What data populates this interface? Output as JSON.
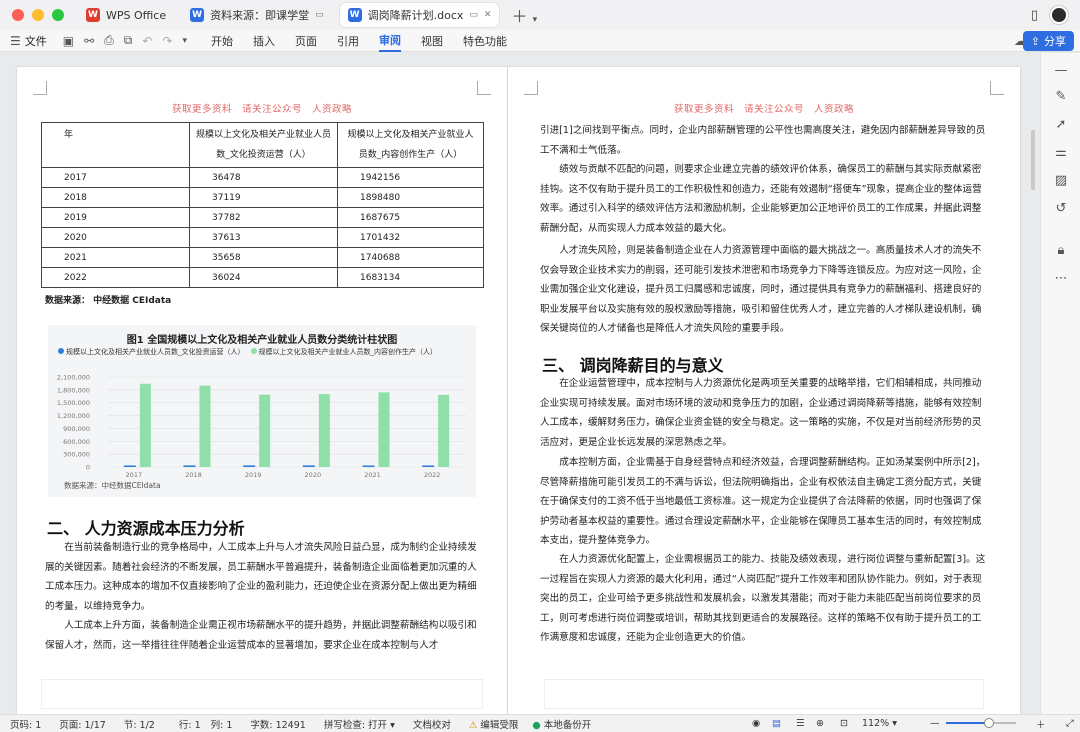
{
  "titlebar": {
    "tabs": [
      {
        "label": "WPS Office",
        "icon": "wps-icon",
        "color": "#e03c2f"
      },
      {
        "label": "资料来源：即课学堂",
        "icon": "word-doc-icon",
        "color": "#2f6ee0"
      },
      {
        "label": "调岗降薪计划.docx",
        "icon": "word-doc-icon",
        "color": "#2f6ee0"
      }
    ]
  },
  "toolbar": {
    "file": "文件",
    "menus": [
      "开始",
      "插入",
      "页面",
      "引用",
      "审阅",
      "视图",
      "特色功能"
    ],
    "active_menu": "审阅",
    "share": "分享"
  },
  "left_page": {
    "watermark": "获取更多资料　请关注公众号　人资政略",
    "table": {
      "headers": [
        "年",
        "规模以上文化及相关产业就业人员数_文化投资运营（人）",
        "规模以上文化及相关产业就业人员数_内容创作生产（人）"
      ],
      "rows": [
        [
          "2017",
          "36478",
          "1942156"
        ],
        [
          "2018",
          "37119",
          "1898480"
        ],
        [
          "2019",
          "37782",
          "1687675"
        ],
        [
          "2020",
          "37613",
          "1701432"
        ],
        [
          "2021",
          "35658",
          "1740688"
        ],
        [
          "2022",
          "36024",
          "1683134"
        ]
      ]
    },
    "source": "数据来源：  中经数据 CEIdata",
    "chart_source": "数据来源：中经数据CEIdata",
    "section_title": "二、  人力资源成本压力分析",
    "paragraphs": [
      "在当前装备制造行业的竞争格局中，人工成本上升与人才流失风险日益凸显，成为制约企业持续发展的关键因素。随着社会经济的不断发展，员工薪酬水平普遍提升，装备制造企业面临着更加沉重的人工成本压力。这种成本的增加不仅直接影响了企业的盈利能力，还迫使企业在资源分配上做出更为精细的考量，以维持竞争力。",
      "人工成本上升方面，装备制造企业需正视市场薪酬水平的提升趋势，并据此调整薪酬结构以吸引和保留人才，然而，这一举措往往伴随着企业运营成本的显著增加，要求企业在成本控制与人才"
    ]
  },
  "chart_data": {
    "type": "bar",
    "title": "图1 全国规模以上文化及相关产业就业人员数分类统计柱状图",
    "categories": [
      "2017",
      "2018",
      "2019",
      "2020",
      "2021",
      "2022"
    ],
    "series": [
      {
        "name": "规模以上文化及相关产业就业人员数_文化投资运营（人）",
        "values": [
          36478,
          37119,
          37782,
          37613,
          35658,
          36024
        ],
        "color": "#2f7fd8"
      },
      {
        "name": "规模以上文化及相关产业就业人员数_内容创作生产（人）",
        "values": [
          1942156,
          1898480,
          1687675,
          1701432,
          1740688,
          1683134
        ],
        "color": "#8fe0a8"
      }
    ],
    "yticks": [
      "0",
      "300,000",
      "600,000",
      "900,000",
      "1,200,000",
      "1,500,000",
      "1,800,000",
      "2,100,000"
    ],
    "ylim": [
      0,
      2100000
    ],
    "legend": "top-left",
    "grid": true
  },
  "right_page": {
    "watermark": "获取更多资料　请关注公众号　人资政略",
    "para1": "引进[1]之间找到平衡点。同时，企业内部薪酬管理的公平性也需高度关注，避免因内部薪酬差异导致的员工不满和士气低落。",
    "para2": "绩效与贡献不匹配的问题，则要求企业建立完善的绩效评价体系，确保员工的薪酬与其实际贡献紧密挂钩。这不仅有助于提升员工的工作积极性和创造力，还能有效遏制“搭便车”现象，提高企业的整体运营效率。通过引入科学的绩效评估方法和激励机制，企业能够更加公正地评价员工的工作成果，并据此调整薪酬分配，从而实现人力成本效益的最大化。",
    "para3": "人才流失风险，则是装备制造企业在人力资源管理中面临的最大挑战之一。高质量技术人才的流失不仅会导致企业技术实力的削弱，还可能引发技术泄密和市场竞争力下降等连锁反应。为应对这一风险，企业需加强企业文化建设，提升员工归属感和忠诚度，同时，通过提供具有竞争力的薪酬福利、搭建良好的职业发展平台以及实施有效的股权激励等措施，吸引和留住优秀人才，建立完善的人才梯队建设机制，确保关键岗位的人才储备也是降低人才流失风险的重要手段。",
    "section_title": "三、  调岗降薪目的与意义",
    "para4": "在企业运营管理中，成本控制与人力资源优化是两项至关重要的战略举措，它们相辅相成，共同推动企业实现可持续发展。面对市场环境的波动和竞争压力的加剧，企业通过调岗降薪等措施，能够有效控制人工成本，缓解财务压力，确保企业资金链的安全与稳定。这一策略的实施，不仅是对当前经济形势的灵活应对，更是企业长远发展的深思熟虑之举。",
    "para5": "成本控制方面，企业需基于自身经营特点和经济效益，合理调整薪酬结构。正如汤某案例中所示[2]，尽管降薪措施可能引发员工的不满与诉讼，但法院明确指出，企业有权依法自主确定工资分配方式，关键在于确保支付的工资不低于当地最低工资标准。这一规定为企业提供了合法降薪的依据，同时也强调了保护劳动者基本权益的重要性。通过合理设定薪酬水平，企业能够在保障员工基本生活的同时，有效控制成本支出，提升整体竞争力。",
    "para6": "在人力资源优化配置上，企业需根据员工的能力、技能及绩效表现，进行岗位调整与重新配置[3]。这一过程旨在实现人力资源的最大化利用，通过“人岗匹配”提升工作效率和团队协作能力。例如，对于表现突出的员工，企业可给予更多挑战性和发展机会，以激发其潜能；而对于能力未能匹配当前岗位要求的员工，则可考虑进行岗位调整或培训，帮助其找到更适合的发展路径。这样的策略不仅有助于提升员工的工作满意度和忠诚度，还能为企业创造更大的价值。"
  },
  "statusbar": {
    "page_no": "页码: 1",
    "page": "页面: 1/17",
    "section": "节: 1/2",
    "row": "行: 1",
    "col": "列: 1",
    "words": "字数: 12491",
    "spell": "拼写检查: 打开",
    "proof": "文档校对",
    "edit_limited": "编辑受限",
    "backup": "本地备份开",
    "zoom": "112%",
    "zoom_level": 0.62
  }
}
